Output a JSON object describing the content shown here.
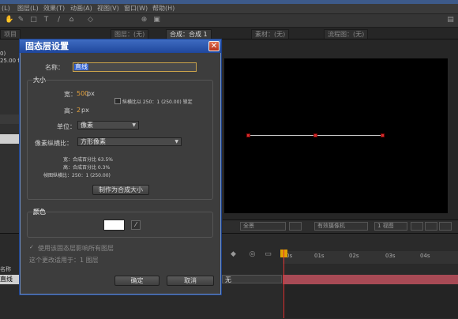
{
  "menubar": {
    "items": [
      "(L)",
      "图层(L)",
      "效果(T)",
      "动画(A)",
      "视图(V)",
      "窗口(W)",
      "帮助(H)"
    ]
  },
  "panel_tabs": {
    "left": "项目",
    "viewer_tab1": "图层：(无)",
    "viewer_tab2": "合成：合成 1",
    "viewer_tab3": "素材：(无)",
    "viewer_tab4": "流程图：(无)"
  },
  "left_panel": {
    "line1": "0)",
    "line2": "25.00 f"
  },
  "dialog": {
    "title": "固态层设置",
    "name_label": "名称：",
    "name_value": "直线",
    "size_group": "大小",
    "width_label": "宽：",
    "width_value": "500",
    "width_unit": "px",
    "height_label": "高：",
    "height_value": "2",
    "height_unit": "px",
    "lock_aspect": "纵横比以 250：1 (250.00) 锁定",
    "units_label": "单位：",
    "units_value": "像素",
    "par_label": "像素纵横比：",
    "par_value": "方形像素",
    "info_width": "宽：合成百分比 63.5%",
    "info_height": "高：合成百分比 0.3%",
    "info_frame": "帧图纵横比：250：1 (250.00)",
    "make_comp_size": "制作为合成大小",
    "color_group": "颜色",
    "color_value": "#ffffff",
    "affect_all": "使用该固态层影响所有图层",
    "applies_count": "这个更改适用于：1 图层",
    "ok": "确定",
    "cancel": "取消"
  },
  "viewer_bar": {
    "view": "全景",
    "quality": "有效摄像机",
    "views": "1 视图"
  },
  "timeline": {
    "ticks": [
      "0s",
      "01s",
      "02s",
      "03s",
      "04s"
    ],
    "layer_name": "直线",
    "name_col": "名称",
    "parent": "无"
  },
  "colors": {
    "dialog_title": "#1f479c",
    "accent_orange": "#e6a23c",
    "timeline_bar": "#a84a55",
    "handle_red": "#d63030"
  }
}
